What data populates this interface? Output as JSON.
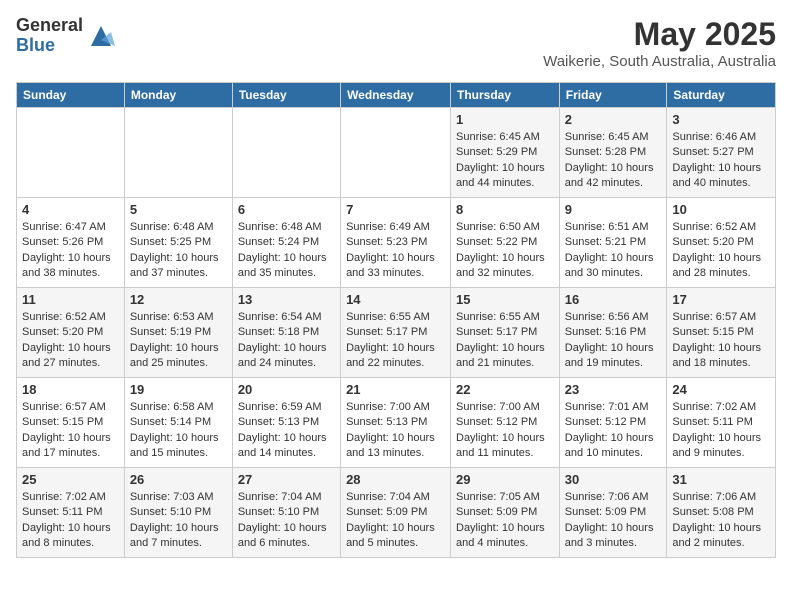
{
  "logo": {
    "general": "General",
    "blue": "Blue"
  },
  "title": "May 2025",
  "location": "Waikerie, South Australia, Australia",
  "days_of_week": [
    "Sunday",
    "Monday",
    "Tuesday",
    "Wednesday",
    "Thursday",
    "Friday",
    "Saturday"
  ],
  "weeks": [
    [
      {
        "day": "",
        "info": ""
      },
      {
        "day": "",
        "info": ""
      },
      {
        "day": "",
        "info": ""
      },
      {
        "day": "",
        "info": ""
      },
      {
        "day": "1",
        "info": "Sunrise: 6:45 AM\nSunset: 5:29 PM\nDaylight: 10 hours\nand 44 minutes."
      },
      {
        "day": "2",
        "info": "Sunrise: 6:45 AM\nSunset: 5:28 PM\nDaylight: 10 hours\nand 42 minutes."
      },
      {
        "day": "3",
        "info": "Sunrise: 6:46 AM\nSunset: 5:27 PM\nDaylight: 10 hours\nand 40 minutes."
      }
    ],
    [
      {
        "day": "4",
        "info": "Sunrise: 6:47 AM\nSunset: 5:26 PM\nDaylight: 10 hours\nand 38 minutes."
      },
      {
        "day": "5",
        "info": "Sunrise: 6:48 AM\nSunset: 5:25 PM\nDaylight: 10 hours\nand 37 minutes."
      },
      {
        "day": "6",
        "info": "Sunrise: 6:48 AM\nSunset: 5:24 PM\nDaylight: 10 hours\nand 35 minutes."
      },
      {
        "day": "7",
        "info": "Sunrise: 6:49 AM\nSunset: 5:23 PM\nDaylight: 10 hours\nand 33 minutes."
      },
      {
        "day": "8",
        "info": "Sunrise: 6:50 AM\nSunset: 5:22 PM\nDaylight: 10 hours\nand 32 minutes."
      },
      {
        "day": "9",
        "info": "Sunrise: 6:51 AM\nSunset: 5:21 PM\nDaylight: 10 hours\nand 30 minutes."
      },
      {
        "day": "10",
        "info": "Sunrise: 6:52 AM\nSunset: 5:20 PM\nDaylight: 10 hours\nand 28 minutes."
      }
    ],
    [
      {
        "day": "11",
        "info": "Sunrise: 6:52 AM\nSunset: 5:20 PM\nDaylight: 10 hours\nand 27 minutes."
      },
      {
        "day": "12",
        "info": "Sunrise: 6:53 AM\nSunset: 5:19 PM\nDaylight: 10 hours\nand 25 minutes."
      },
      {
        "day": "13",
        "info": "Sunrise: 6:54 AM\nSunset: 5:18 PM\nDaylight: 10 hours\nand 24 minutes."
      },
      {
        "day": "14",
        "info": "Sunrise: 6:55 AM\nSunset: 5:17 PM\nDaylight: 10 hours\nand 22 minutes."
      },
      {
        "day": "15",
        "info": "Sunrise: 6:55 AM\nSunset: 5:17 PM\nDaylight: 10 hours\nand 21 minutes."
      },
      {
        "day": "16",
        "info": "Sunrise: 6:56 AM\nSunset: 5:16 PM\nDaylight: 10 hours\nand 19 minutes."
      },
      {
        "day": "17",
        "info": "Sunrise: 6:57 AM\nSunset: 5:15 PM\nDaylight: 10 hours\nand 18 minutes."
      }
    ],
    [
      {
        "day": "18",
        "info": "Sunrise: 6:57 AM\nSunset: 5:15 PM\nDaylight: 10 hours\nand 17 minutes."
      },
      {
        "day": "19",
        "info": "Sunrise: 6:58 AM\nSunset: 5:14 PM\nDaylight: 10 hours\nand 15 minutes."
      },
      {
        "day": "20",
        "info": "Sunrise: 6:59 AM\nSunset: 5:13 PM\nDaylight: 10 hours\nand 14 minutes."
      },
      {
        "day": "21",
        "info": "Sunrise: 7:00 AM\nSunset: 5:13 PM\nDaylight: 10 hours\nand 13 minutes."
      },
      {
        "day": "22",
        "info": "Sunrise: 7:00 AM\nSunset: 5:12 PM\nDaylight: 10 hours\nand 11 minutes."
      },
      {
        "day": "23",
        "info": "Sunrise: 7:01 AM\nSunset: 5:12 PM\nDaylight: 10 hours\nand 10 minutes."
      },
      {
        "day": "24",
        "info": "Sunrise: 7:02 AM\nSunset: 5:11 PM\nDaylight: 10 hours\nand 9 minutes."
      }
    ],
    [
      {
        "day": "25",
        "info": "Sunrise: 7:02 AM\nSunset: 5:11 PM\nDaylight: 10 hours\nand 8 minutes."
      },
      {
        "day": "26",
        "info": "Sunrise: 7:03 AM\nSunset: 5:10 PM\nDaylight: 10 hours\nand 7 minutes."
      },
      {
        "day": "27",
        "info": "Sunrise: 7:04 AM\nSunset: 5:10 PM\nDaylight: 10 hours\nand 6 minutes."
      },
      {
        "day": "28",
        "info": "Sunrise: 7:04 AM\nSunset: 5:09 PM\nDaylight: 10 hours\nand 5 minutes."
      },
      {
        "day": "29",
        "info": "Sunrise: 7:05 AM\nSunset: 5:09 PM\nDaylight: 10 hours\nand 4 minutes."
      },
      {
        "day": "30",
        "info": "Sunrise: 7:06 AM\nSunset: 5:09 PM\nDaylight: 10 hours\nand 3 minutes."
      },
      {
        "day": "31",
        "info": "Sunrise: 7:06 AM\nSunset: 5:08 PM\nDaylight: 10 hours\nand 2 minutes."
      }
    ]
  ]
}
